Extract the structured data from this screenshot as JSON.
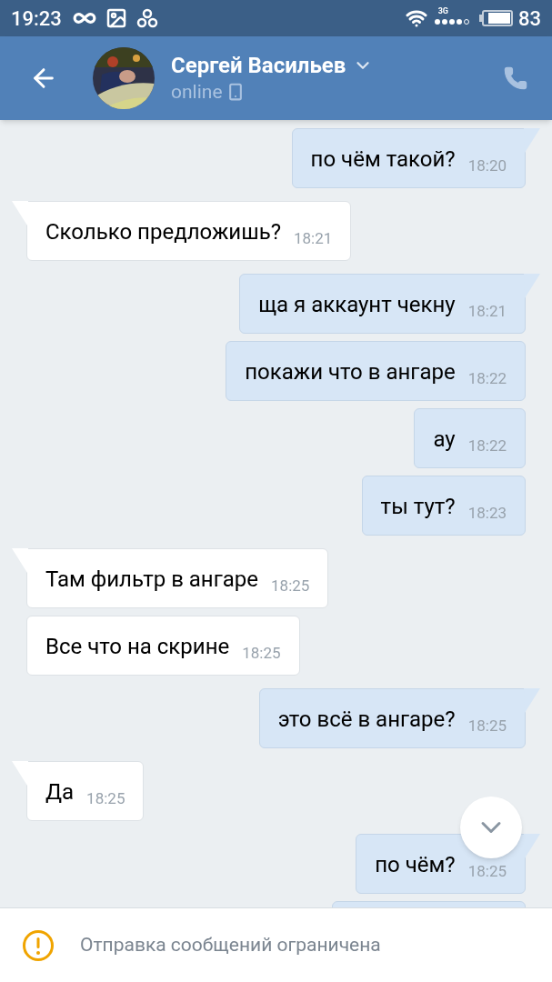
{
  "status_bar": {
    "time": "19:23",
    "network": "3G",
    "battery": "83"
  },
  "header": {
    "name": "Сергей Васильев",
    "status": "online"
  },
  "messages": [
    {
      "kind": "out",
      "text": "по чём такой?",
      "time": "18:20"
    },
    {
      "kind": "in",
      "text": "Сколько предложишь?",
      "time": "18:21"
    },
    {
      "kind": "out",
      "text": "ща я аккаунт чекну",
      "time": "18:21"
    },
    {
      "kind": "out",
      "text": "покажи что в ангаре",
      "time": "18:22"
    },
    {
      "kind": "out",
      "text": "ау",
      "time": "18:22"
    },
    {
      "kind": "out",
      "text": "ты тут?",
      "time": "18:23"
    },
    {
      "kind": "in",
      "text": "Там фильтр в ангаре",
      "time": "18:25"
    },
    {
      "kind": "in",
      "text": "Все что на скрине",
      "time": "18:25"
    },
    {
      "kind": "out",
      "text": "это всё в ангаре?",
      "time": "18:25"
    },
    {
      "kind": "in",
      "text": "Да",
      "time": "18:25"
    },
    {
      "kind": "out",
      "text": "по чём?",
      "time": "18:25"
    }
  ],
  "notice": {
    "text": "Отправка сообщений ограничена"
  }
}
